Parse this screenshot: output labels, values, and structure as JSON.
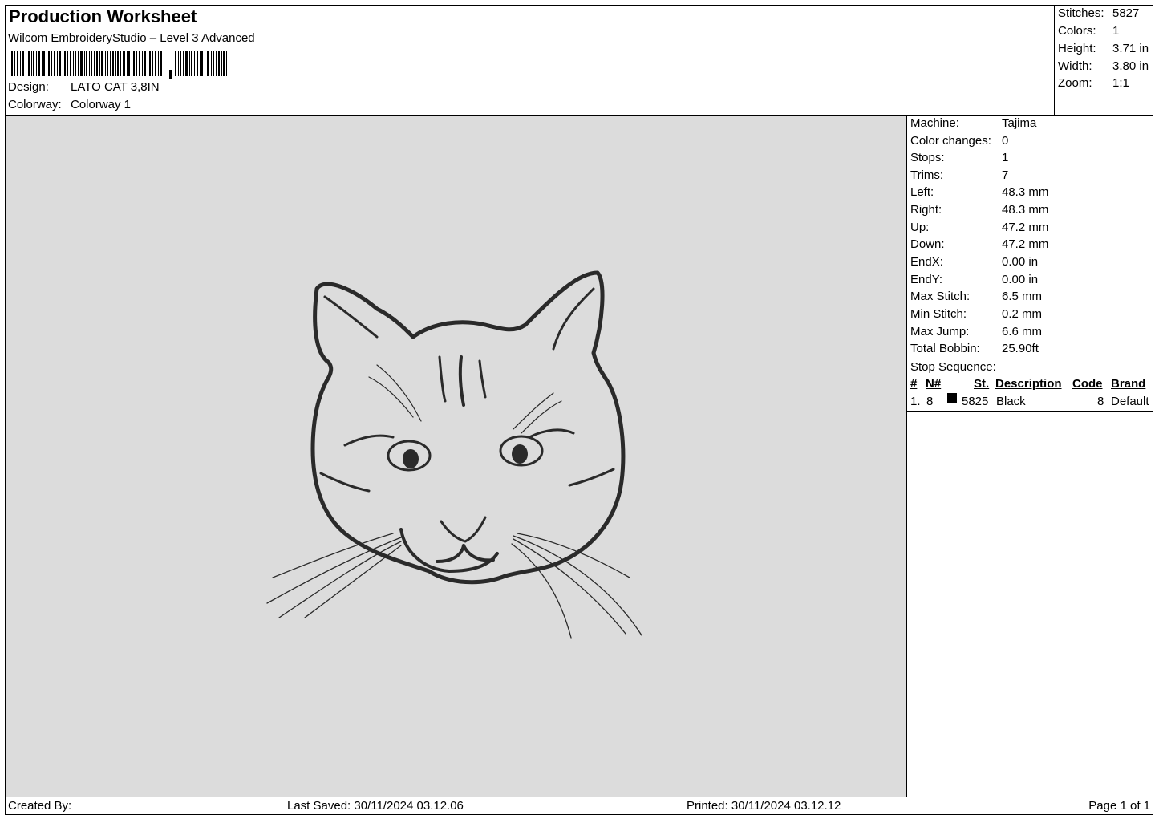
{
  "header": {
    "title": "Production Worksheet",
    "subtitle": "Wilcom EmbroideryStudio – Level 3 Advanced",
    "design_label": "Design:",
    "design_value": "LATO CAT 3,8IN",
    "colorway_label": "Colorway:",
    "colorway_value": "Colorway 1"
  },
  "stats": [
    {
      "label": "Stitches:",
      "value": "5827"
    },
    {
      "label": "Colors:",
      "value": "1"
    },
    {
      "label": "Height:",
      "value": "3.71 in"
    },
    {
      "label": "Width:",
      "value": "3.80 in"
    },
    {
      "label": "Zoom:",
      "value": "1:1"
    }
  ],
  "machine": [
    {
      "label": "Machine:",
      "value": "Tajima"
    },
    {
      "label": "Color changes:",
      "value": "0"
    },
    {
      "label": "Stops:",
      "value": "1"
    },
    {
      "label": "Trims:",
      "value": "7"
    },
    {
      "label": "Left:",
      "value": "48.3 mm"
    },
    {
      "label": "Right:",
      "value": "48.3 mm"
    },
    {
      "label": "Up:",
      "value": "47.2 mm"
    },
    {
      "label": "Down:",
      "value": "47.2 mm"
    },
    {
      "label": "EndX:",
      "value": "0.00 in"
    },
    {
      "label": "EndY:",
      "value": "0.00 in"
    },
    {
      "label": "Max Stitch:",
      "value": "6.5 mm"
    },
    {
      "label": "Min Stitch:",
      "value": "0.2 mm"
    },
    {
      "label": "Max Jump:",
      "value": "6.6 mm"
    },
    {
      "label": "Total Bobbin:",
      "value": "25.90ft"
    }
  ],
  "stop_sequence": {
    "title": "Stop Sequence:",
    "headers": {
      "num": "#",
      "needle": "N#",
      "stitches": "St.",
      "description": "Description",
      "code": "Code",
      "brand": "Brand"
    },
    "rows": [
      {
        "num": "1.",
        "needle": "8",
        "stitches": "5825",
        "description": "Black",
        "code": "8",
        "brand": "Default",
        "color": "#000000"
      }
    ]
  },
  "footer": {
    "created_by": "Created By:",
    "last_saved": "Last Saved: 30/11/2024 03.12.06",
    "printed": "Printed: 30/11/2024 03.12.12",
    "page": "Page 1 of 1"
  },
  "design_preview": {
    "subject": "cat-face-outline",
    "thread_color": "#2a2a2a",
    "background_color": "#dcdcdc"
  }
}
